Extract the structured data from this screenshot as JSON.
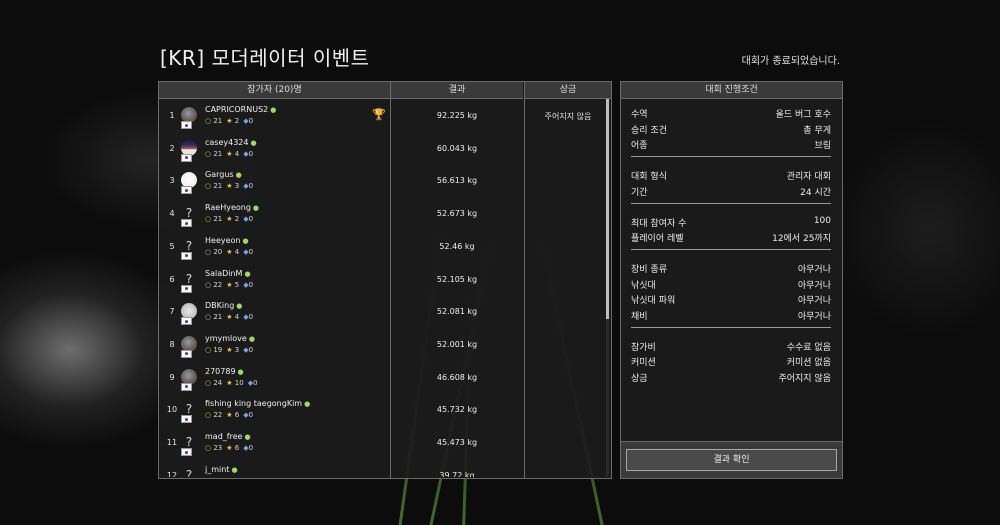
{
  "title": "[KR] 모더레이터 이벤트",
  "status": "대회가 종료되었습니다.",
  "table": {
    "headers": {
      "participants": "참가자 (20)명",
      "result": "결과",
      "prize": "상금"
    },
    "rows": [
      {
        "rank": "1",
        "name": "CAPRICORNUS2",
        "level": "21",
        "stars": "2",
        "gems": "0",
        "result": "92.225 kg",
        "prize": "주어지지 않음",
        "avatar": "pic",
        "trophy": true
      },
      {
        "rank": "2",
        "name": "casey4324",
        "level": "21",
        "stars": "4",
        "gems": "0",
        "result": "60.043 kg",
        "prize": "",
        "avatar": "pic2"
      },
      {
        "rank": "3",
        "name": "Gargus",
        "level": "21",
        "stars": "3",
        "gems": "0",
        "result": "56.613 kg",
        "prize": "",
        "avatar": "pic3"
      },
      {
        "rank": "4",
        "name": "RaeHyeong",
        "level": "21",
        "stars": "2",
        "gems": "0",
        "result": "52.673 kg",
        "prize": "",
        "avatar": "none"
      },
      {
        "rank": "5",
        "name": "Heeyeon",
        "level": "20",
        "stars": "4",
        "gems": "0",
        "result": "52.46 kg",
        "prize": "",
        "avatar": "none"
      },
      {
        "rank": "6",
        "name": "SalaDinM",
        "level": "22",
        "stars": "5",
        "gems": "0",
        "result": "52.105 kg",
        "prize": "",
        "avatar": "none"
      },
      {
        "rank": "7",
        "name": "DBKing",
        "level": "21",
        "stars": "4",
        "gems": "0",
        "result": "52.081 kg",
        "prize": "",
        "avatar": "pic4"
      },
      {
        "rank": "8",
        "name": "ymymlove",
        "level": "19",
        "stars": "3",
        "gems": "0",
        "result": "52.001 kg",
        "prize": "",
        "avatar": "pic"
      },
      {
        "rank": "9",
        "name": "270789",
        "level": "24",
        "stars": "10",
        "gems": "0",
        "result": "46.608 kg",
        "prize": "",
        "avatar": "pic"
      },
      {
        "rank": "10",
        "name": "fishing king taegongKim",
        "level": "22",
        "stars": "6",
        "gems": "0",
        "result": "45.732 kg",
        "prize": "",
        "avatar": "none"
      },
      {
        "rank": "11",
        "name": "mad_free",
        "level": "23",
        "stars": "6",
        "gems": "0",
        "result": "45.473 kg",
        "prize": "",
        "avatar": "none"
      },
      {
        "rank": "12",
        "name": "j_mint",
        "level": "",
        "stars": "",
        "gems": "",
        "result": "39.72 kg",
        "prize": "",
        "avatar": "none"
      }
    ]
  },
  "conditions": {
    "header": "대회 진행조건",
    "groups": [
      [
        {
          "k": "수역",
          "v": "올드 버그 호수"
        },
        {
          "k": "승리 조건",
          "v": "총 무게"
        },
        {
          "k": "어종",
          "v": "브림"
        }
      ],
      [
        {
          "k": "대회 형식",
          "v": "관리자 대회"
        },
        {
          "k": "기간",
          "v": "24 시간"
        }
      ],
      [
        {
          "k": "최대 참여자 수",
          "v": "100"
        },
        {
          "k": "플레이어 레벨",
          "v": "12에서 25까지"
        }
      ],
      [
        {
          "k": "장비 종류",
          "v": "아무거나"
        },
        {
          "k": "낚싯대",
          "v": "아무거나"
        },
        {
          "k": "낚싯대 파워",
          "v": "아무거나"
        },
        {
          "k": "채비",
          "v": "아무거나"
        }
      ],
      [
        {
          "k": "참가비",
          "v": "수수료 없음"
        },
        {
          "k": "커미션",
          "v": "커미션 없음"
        },
        {
          "k": "상금",
          "v": "주어지지 않음"
        }
      ]
    ],
    "button": "결과 확인"
  },
  "colors": {
    "panel_border": "#6b6b6b",
    "level": "#a6d64b",
    "star": "#f0c43a",
    "gem": "#6aa6f0",
    "trophy": "#f0c43a"
  },
  "icons": {
    "level": "level-circle-icon",
    "star": "star-icon",
    "gem": "gem-icon",
    "trophy": "trophy-icon",
    "flag": "korea-flag-icon"
  }
}
